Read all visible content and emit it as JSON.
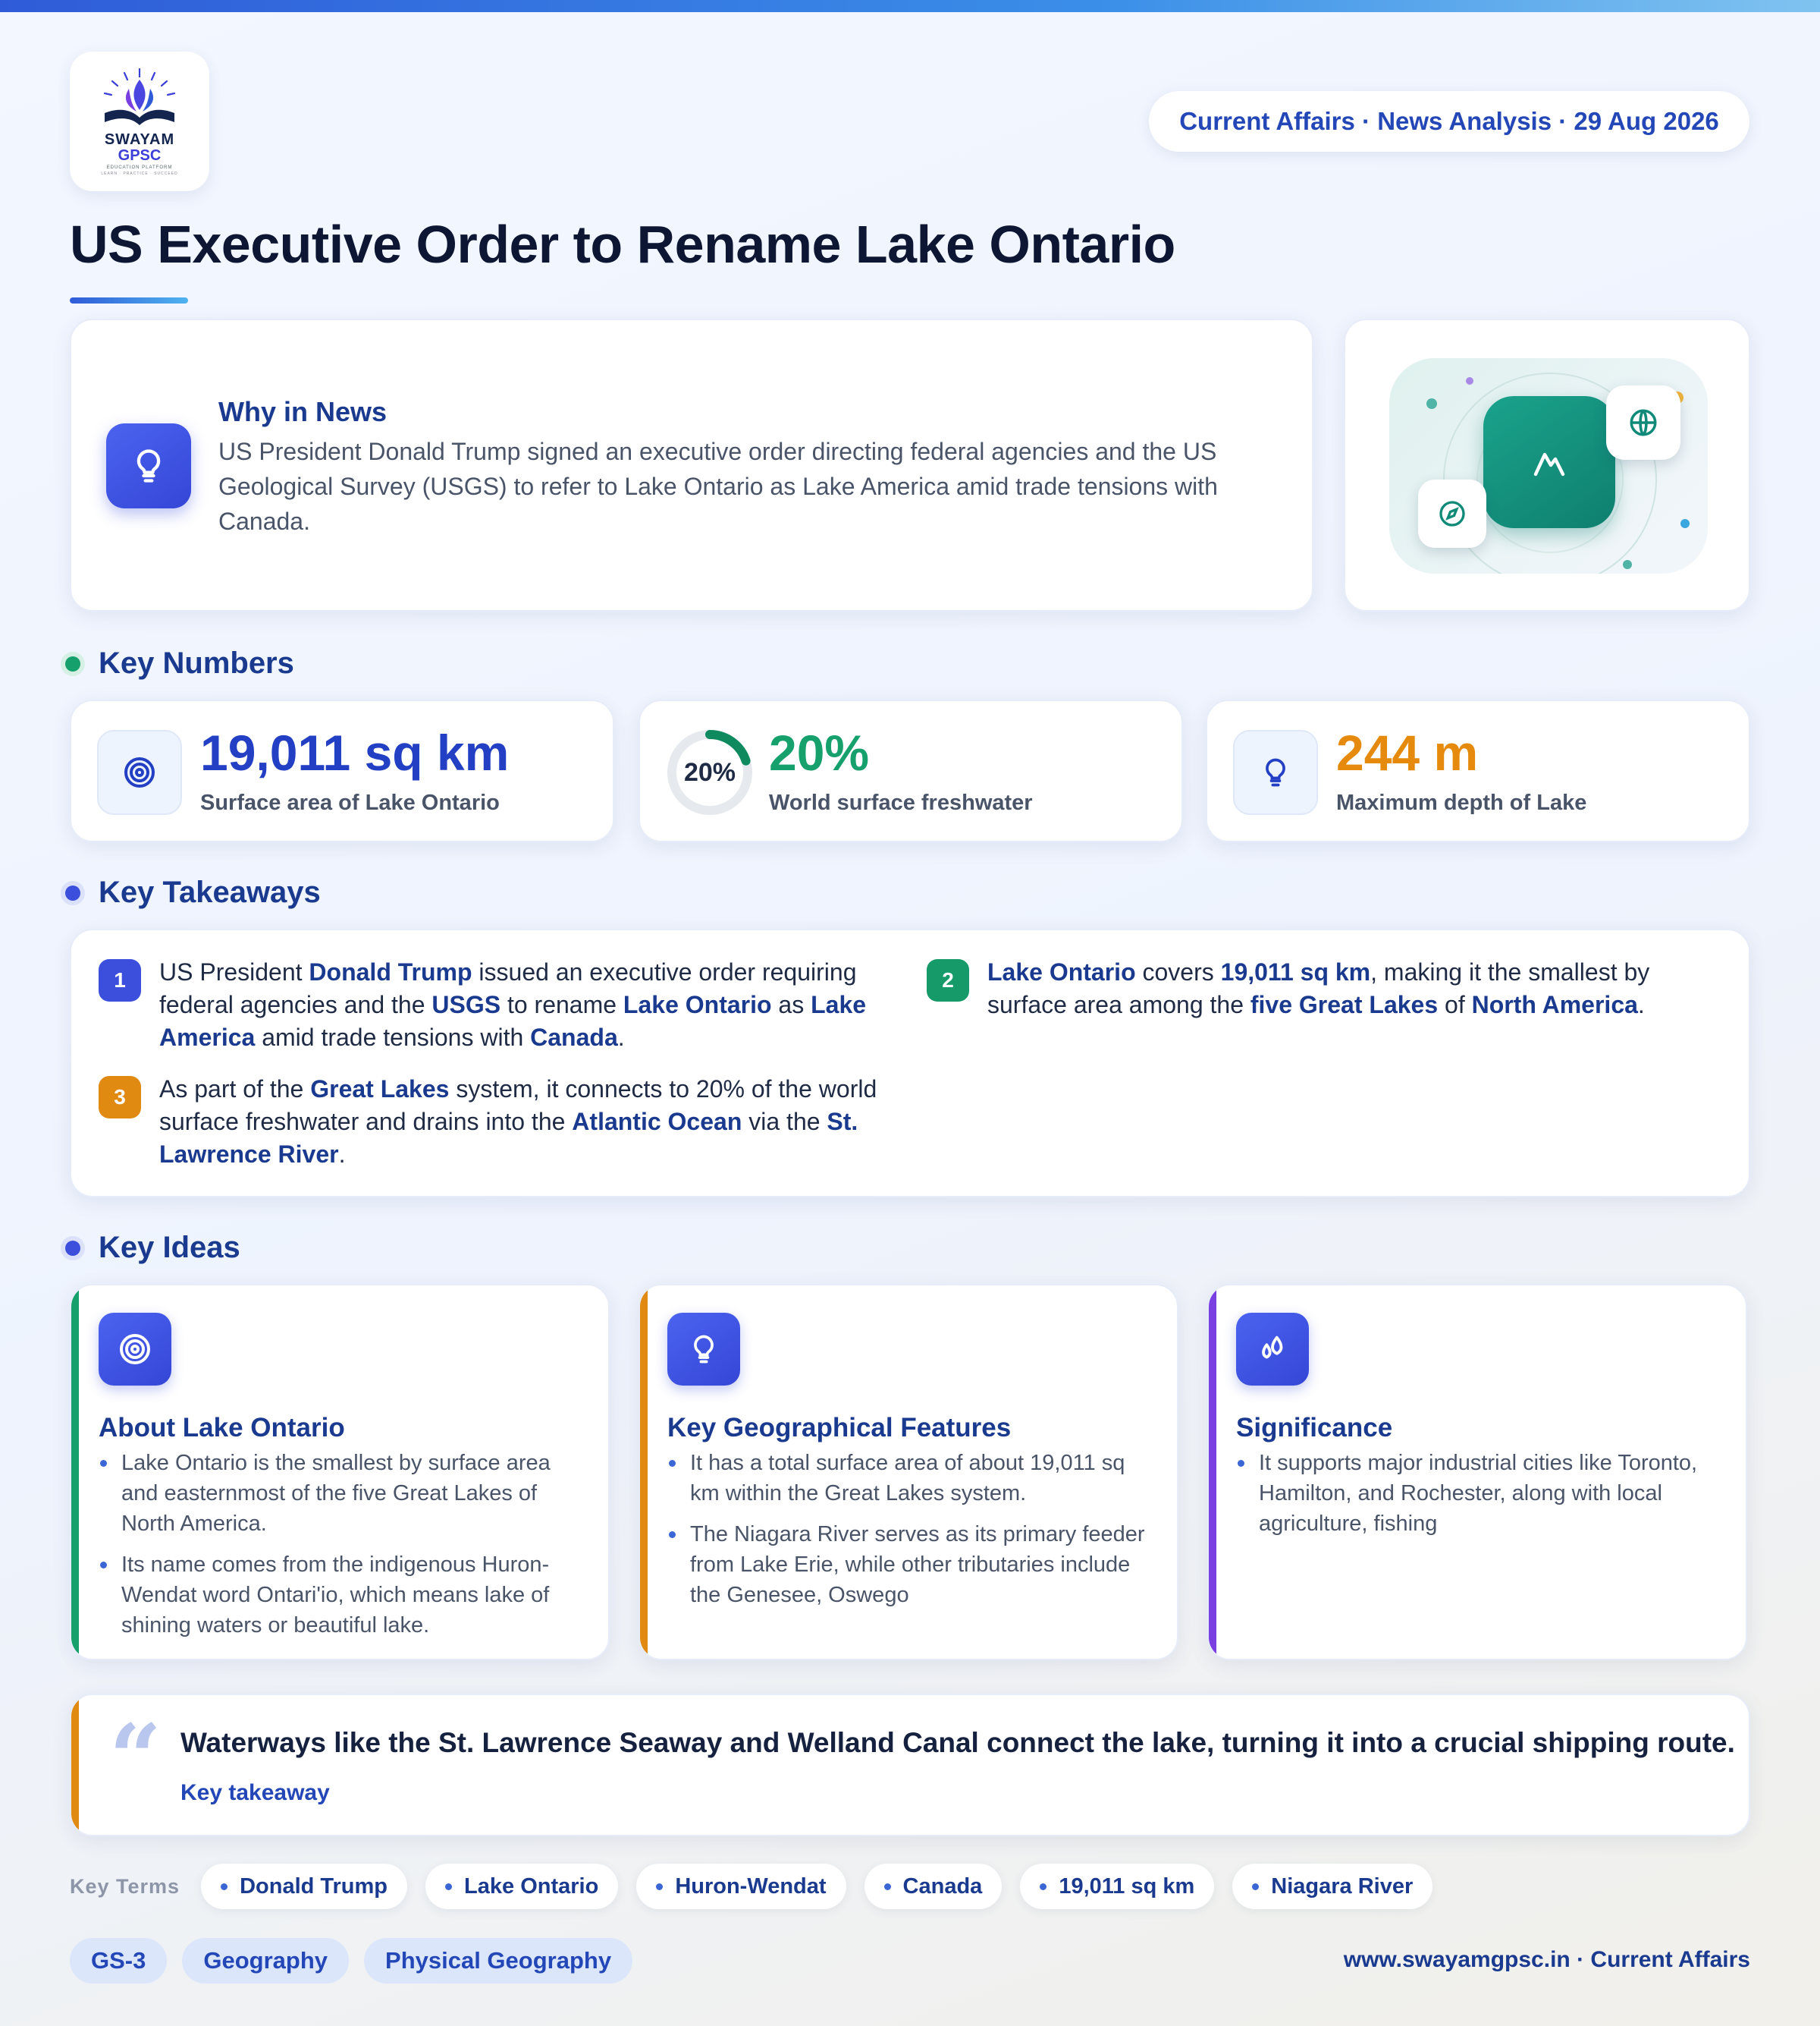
{
  "brand": {
    "name": "SWAYAM",
    "sub": "GPSC",
    "tagline": "EDUCATION PLATFORM",
    "motto": "LEARN · PRACTICE · SUCCEED"
  },
  "header": {
    "meta": "Current Affairs · News Analysis · 29 Aug 2026",
    "title": "US Executive Order to Rename Lake Ontario"
  },
  "why": {
    "heading": "Why in News",
    "body": "US President Donald Trump signed an executive order directing federal agencies and the US Geological Survey (USGS) to refer to Lake Ontario as Lake America amid trade tensions with Canada."
  },
  "sections": {
    "numbers": "Key Numbers",
    "takeaways": "Key Takeaways",
    "ideas": "Key Ideas"
  },
  "stats": [
    {
      "value": "19,011 sq km",
      "label": "Surface area of Lake Ontario",
      "color": "#2340c4",
      "icon": "target-icon"
    },
    {
      "value": "20%",
      "label": "World surface freshwater",
      "color": "#16a06b",
      "ring_label": "20%",
      "ring_fraction": 0.2
    },
    {
      "value": "244 m",
      "label": "Maximum depth of Lake",
      "color": "#e58a0c",
      "icon": "bulb-icon"
    }
  ],
  "takeaways": [
    {
      "num": "1",
      "color": "#3b4fdc",
      "parts": [
        {
          "t": "US President "
        },
        {
          "t": "Donald Trump",
          "b": true
        },
        {
          "t": " issued an executive order requiring federal agencies and the "
        },
        {
          "t": "USGS",
          "b": true
        },
        {
          "t": " to rename "
        },
        {
          "t": "Lake Ontario",
          "b": true
        },
        {
          "t": " as "
        },
        {
          "t": "Lake America",
          "b": true
        },
        {
          "t": " amid trade tensions with "
        },
        {
          "t": "Canada",
          "b": true
        },
        {
          "t": "."
        }
      ]
    },
    {
      "num": "2",
      "color": "#169a6a",
      "parts": [
        {
          "t": "Lake Ontario",
          "b": true
        },
        {
          "t": " covers "
        },
        {
          "t": "19,011 sq km",
          "b": true
        },
        {
          "t": ", making it the smallest by surface area among the "
        },
        {
          "t": "five Great Lakes",
          "b": true
        },
        {
          "t": " of "
        },
        {
          "t": "North America",
          "b": true
        },
        {
          "t": "."
        }
      ]
    },
    {
      "num": "3",
      "color": "#e08a12",
      "parts": [
        {
          "t": "As part of the "
        },
        {
          "t": "Great Lakes",
          "b": true
        },
        {
          "t": " system, it connects to 20% of the world surface freshwater and drains into the "
        },
        {
          "t": "Atlantic Ocean",
          "b": true
        },
        {
          "t": " via the "
        },
        {
          "t": "St. Lawrence River",
          "b": true
        },
        {
          "t": "."
        }
      ]
    }
  ],
  "ideas": [
    {
      "title": "About Lake Ontario",
      "accent": "#16a06b",
      "icon": "target-icon",
      "points": [
        "Lake Ontario is the smallest by surface area and easternmost of the five Great Lakes of North America.",
        "Its name comes from the indigenous Huron-Wendat word Ontari'io, which means lake of shining waters or beautiful lake."
      ]
    },
    {
      "title": "Key Geographical Features",
      "accent": "#e08a12",
      "icon": "bulb-icon",
      "points": [
        "It has a total surface area of about 19,011 sq km within the Great Lakes system.",
        "The Niagara River serves as its primary feeder from Lake Erie, while other tributaries include the Genesee, Oswego"
      ]
    },
    {
      "title": "Significance",
      "accent": "#7a3fe0",
      "icon": "drops-icon",
      "points": [
        "It supports major industrial cities like Toronto, Hamilton, and Rochester, along with local agriculture, fishing"
      ]
    }
  ],
  "quote": {
    "mark": "“",
    "text": "Waterways like the St. Lawrence Seaway and Welland Canal connect the lake, turning it into a crucial shipping route.",
    "sub": "Key takeaway"
  },
  "terms": {
    "label": "Key Terms",
    "items": [
      "Donald Trump",
      "Lake Ontario",
      "Huron-Wendat",
      "Canada",
      "19,011 sq km",
      "Niagara River"
    ]
  },
  "tags": [
    "GS-3",
    "Geography",
    "Physical Geography"
  ],
  "footer": "www.swayamgpsc.in · Current Affairs"
}
